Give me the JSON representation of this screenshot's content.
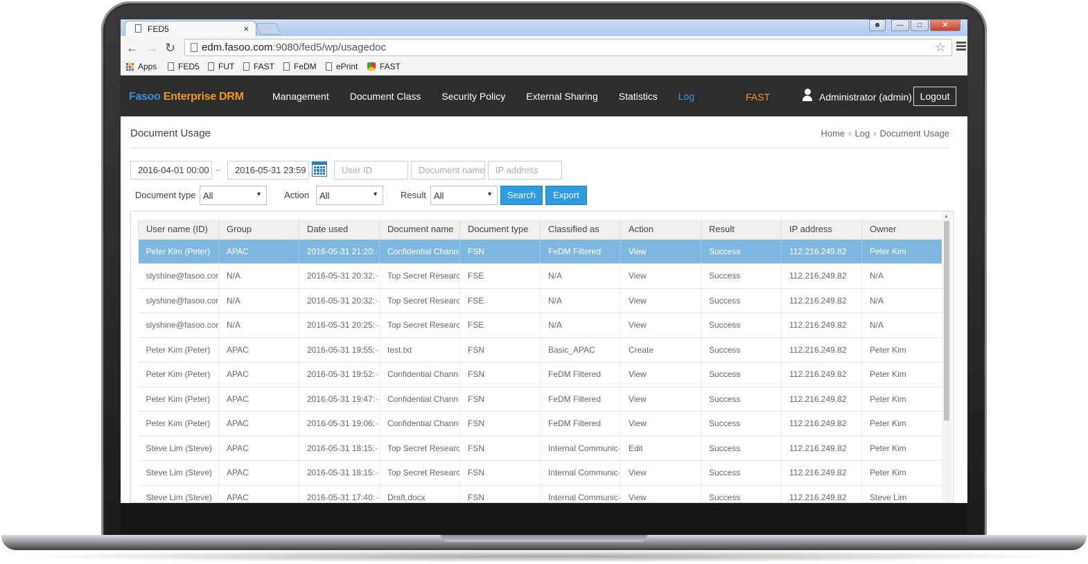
{
  "browser": {
    "tab_title": "FED5",
    "tab_close": "×",
    "url_host": "edm.fasoo.com",
    "url_rest": ":9080/fed5/wp/usagedoc",
    "bookmarks": [
      "Apps",
      "FED5",
      "FUT",
      "FAST",
      "FeDM",
      "ePrint",
      "FAST"
    ]
  },
  "app": {
    "logo_part1": "Fasoo",
    "logo_part2": " Enterprise DRM",
    "nav": [
      "Management",
      "Document Class",
      "Security Policy",
      "External Sharing",
      "Statistics",
      "Log"
    ],
    "active_nav": "Log",
    "fast_label": "FAST",
    "user_name": "Administrator (admin)",
    "logout_label": "Logout"
  },
  "page": {
    "title": "Document Usage",
    "breadcrumb": [
      "Home",
      "Log",
      "Document Usage"
    ]
  },
  "filters": {
    "date_from": "2016-04-01 00:00",
    "date_sep": "~",
    "date_to": "2016-05-31 23:59",
    "user_id_placeholder": "User ID",
    "document_name_placeholder": "Document name",
    "ip_address_placeholder": "IP address",
    "document_type_label": "Document type",
    "document_type_value": "All",
    "action_label": "Action",
    "action_value": "All",
    "result_label": "Result",
    "result_value": "All",
    "search_label": "Search",
    "export_label": "Export"
  },
  "table": {
    "columns": [
      "User name (ID)",
      "Group",
      "Date used",
      "Document name",
      "Document type",
      "Classified as",
      "Action",
      "Result",
      "IP address",
      "Owner"
    ],
    "rows": [
      [
        "Peter Kim (Peter)",
        "APAC",
        "2016-05-31 21:20:···",
        "Confidential Chann···",
        "FSN",
        "FeDM Filtered",
        "View",
        "Success",
        "112.216.249.82",
        "Peter Kim"
      ],
      [
        "slyshine@fasoo.com···",
        "N/A",
        "2016-05-31 20:32:···",
        "Top Secret Research···",
        "FSE",
        "N/A",
        "View",
        "Success",
        "112.216.249.82",
        "N/A"
      ],
      [
        "slyshine@fasoo.com···",
        "N/A",
        "2016-05-31 20:32:···",
        "Top Secret Research···",
        "FSE",
        "N/A",
        "View",
        "Success",
        "112.216.249.82",
        "N/A"
      ],
      [
        "slyshine@fasoo.com···",
        "N/A",
        "2016-05-31 20:25:···",
        "Top Secret Research···",
        "FSE",
        "N/A",
        "View",
        "Success",
        "112.216.249.82",
        "N/A"
      ],
      [
        "Peter Kim (Peter)",
        "APAC",
        "2016-05-31 19:55:···",
        "test.txt",
        "FSN",
        "Basic_APAC",
        "Create",
        "Success",
        "112.216.249.82",
        "Peter Kim"
      ],
      [
        "Peter Kim (Peter)",
        "APAC",
        "2016-05-31 19:52:···",
        "Confidential Chann···",
        "FSN",
        "FeDM Filtered",
        "View",
        "Success",
        "112.216.249.82",
        "Peter Kim"
      ],
      [
        "Peter Kim (Peter)",
        "APAC",
        "2016-05-31 19:47:···",
        "Confidential Chann···",
        "FSN",
        "FeDM Filtered",
        "View",
        "Success",
        "112.216.249.82",
        "Peter Kim"
      ],
      [
        "Peter Kim (Peter)",
        "APAC",
        "2016-05-31 19:06:···",
        "Confidential Chann···",
        "FSN",
        "FeDM Filtered",
        "View",
        "Success",
        "112.216.249.82",
        "Peter Kim"
      ],
      [
        "Steve Lim (Steve)",
        "APAC",
        "2016-05-31 18:15:···",
        "Top Secret Research···",
        "FSN",
        "Internal Communic···",
        "Edit",
        "Success",
        "112.216.249.82",
        "Peter Kim"
      ],
      [
        "Steve Lim (Steve)",
        "APAC",
        "2016-05-31 18:15:···",
        "Top Secret Research···",
        "FSN",
        "Internal Communic···",
        "View",
        "Success",
        "112.216.249.82",
        "Peter Kim"
      ],
      [
        "Steve Lim (Steve)",
        "APAC",
        "2016-05-31 17:40:···",
        "Draft.docx",
        "FSN",
        "Internal Communic···",
        "View",
        "Success",
        "112.216.249.82",
        "Steve Lim"
      ]
    ],
    "selected_row": 0
  },
  "colors": {
    "accent": "#2e9ae0",
    "header_bg": "#2d2d2d",
    "selected_row": "#7fb8df",
    "brand_orange": "#f29c1f"
  }
}
